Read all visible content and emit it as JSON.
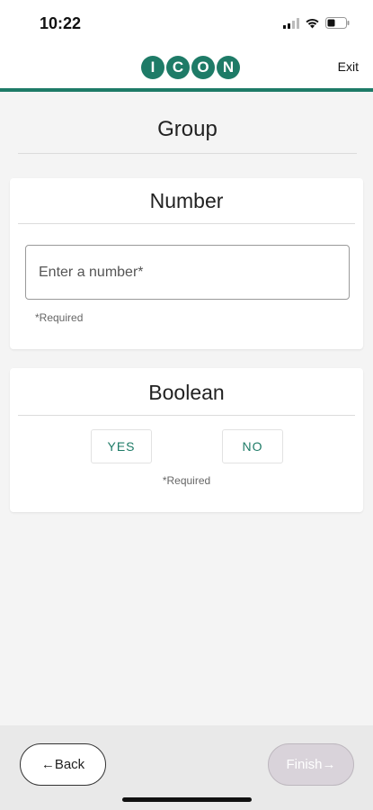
{
  "status_bar": {
    "time": "10:22",
    "icons": [
      "cellular-signal-icon",
      "wifi-icon",
      "battery-icon"
    ]
  },
  "header": {
    "logo_letters": [
      "I",
      "C",
      "O",
      "N"
    ],
    "exit_label": "Exit",
    "accent_color": "#1e7b67"
  },
  "group": {
    "title": "Group"
  },
  "number_question": {
    "title": "Number",
    "input_value": "",
    "input_placeholder": "Enter a number*",
    "required_note": "*Required"
  },
  "boolean_question": {
    "title": "Boolean",
    "yes_label": "YES",
    "no_label": "NO",
    "required_note": "*Required"
  },
  "footer": {
    "back_label": "←Back",
    "finish_label": "Finish→"
  }
}
